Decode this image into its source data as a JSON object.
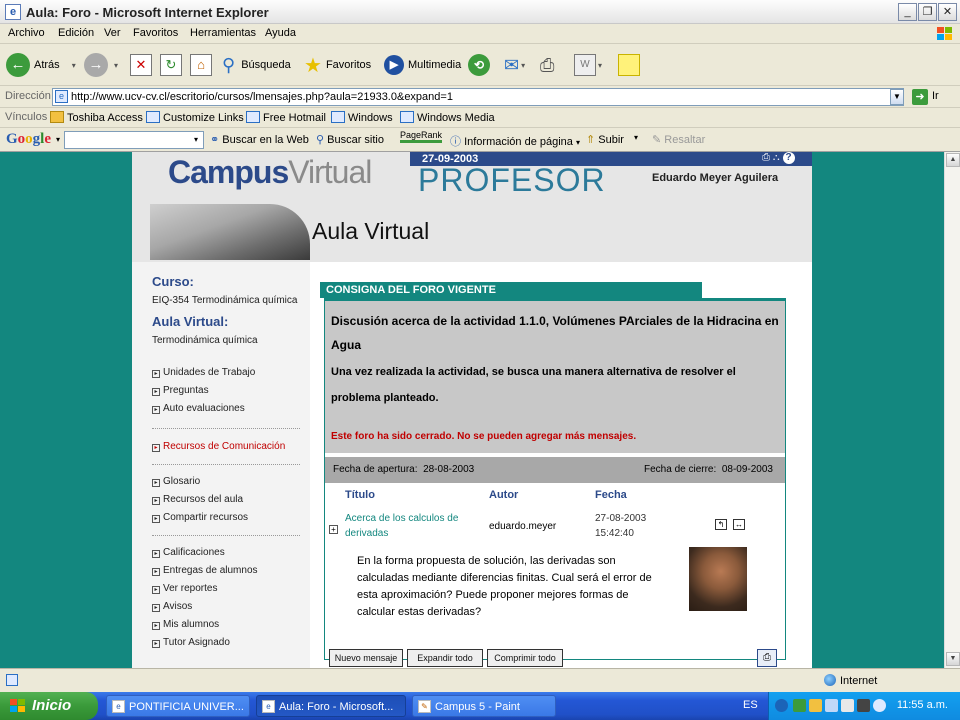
{
  "window": {
    "title": "Aula: Foro - Microsoft Internet Explorer"
  },
  "menu": [
    "Archivo",
    "Edición",
    "Ver",
    "Favoritos",
    "Herramientas",
    "Ayuda"
  ],
  "toolbar": {
    "back": "Atrás",
    "search": "Búsqueda",
    "favorites": "Favoritos",
    "media": "Multimedia"
  },
  "address": {
    "label": "Dirección",
    "url": "http://www.ucv-cv.cl/escritorio/cursos/lmensajes.php?aula=21933.0&expand=1",
    "go": "Ir"
  },
  "links": {
    "label": "Vínculos",
    "items": [
      "Toshiba Access",
      "Customize Links",
      "Free Hotmail",
      "Windows",
      "Windows Media"
    ]
  },
  "google": {
    "logo": "Google",
    "web": "Buscar en la Web",
    "site": "Buscar sitio",
    "pagerank": "PageRank",
    "info": "Información de página",
    "up": "Subir",
    "highlight": "Resaltar"
  },
  "site": {
    "logo_bold": "Campus",
    "logo_light": "Virtual",
    "date": "27-09-2003",
    "role": "PROFESOR",
    "user": "Eduardo Meyer Aguilera",
    "section": "Aula Virtual"
  },
  "sidebar": {
    "course_label": "Curso:",
    "course": "EIQ-354 Termodinámica química",
    "aula_label": "Aula Virtual:",
    "aula": "Termodinámica química",
    "group1": [
      "Unidades de Trabajo",
      "Preguntas",
      "Auto evaluaciones"
    ],
    "group2": [
      "Recursos de Comunicación"
    ],
    "group3": [
      "Glosario",
      "Recursos del aula",
      "Compartir recursos"
    ],
    "group4": [
      "Calificaciones",
      "Entregas de alumnos",
      "Ver reportes",
      "Avisos",
      "Mis alumnos",
      "Tutor Asignado"
    ]
  },
  "forum": {
    "banner": "CONSIGNA DEL FORO VIGENTE",
    "title": "Discusión acerca de la actividad 1.1.0, Volúmenes PArciales de la Hidracina en Agua",
    "description": "Una vez realizada la actividad, se busca una manera alternativa de resolver el problema planteado.",
    "closed": "Este foro ha sido cerrado. No se pueden agregar más mensajes.",
    "open_label": "Fecha de apertura:",
    "open_date": "28-08-2003",
    "close_label": "Fecha de cierre:",
    "close_date": "08-09-2003",
    "columns": [
      "Título",
      "Autor",
      "Fecha"
    ],
    "message": {
      "title": "Acerca de los calculos de derivadas",
      "author": "eduardo.meyer",
      "date": "27-08-2003",
      "time": "15:42:40",
      "body": "En la forma propuesta de solución, las derivadas son calculadas mediante diferencias finitas. Cual será el error de esta aproximación? Puede proponer mejores formas de calcular estas derivadas?"
    },
    "buttons": {
      "new": "Nuevo mensaje",
      "expand": "Expandir todo",
      "collapse": "Comprimir todo"
    }
  },
  "status": {
    "zone": "Internet"
  },
  "taskbar": {
    "start": "Inicio",
    "tasks": [
      "PONTIFICIA UNIVER...",
      "Aula: Foro - Microsoft...",
      "Campus 5 - Paint"
    ],
    "lang": "ES",
    "clock": "11:55 a.m."
  },
  "colors": {
    "teal": "#13877f",
    "navy": "#2c4a8a",
    "red": "#c00000"
  }
}
